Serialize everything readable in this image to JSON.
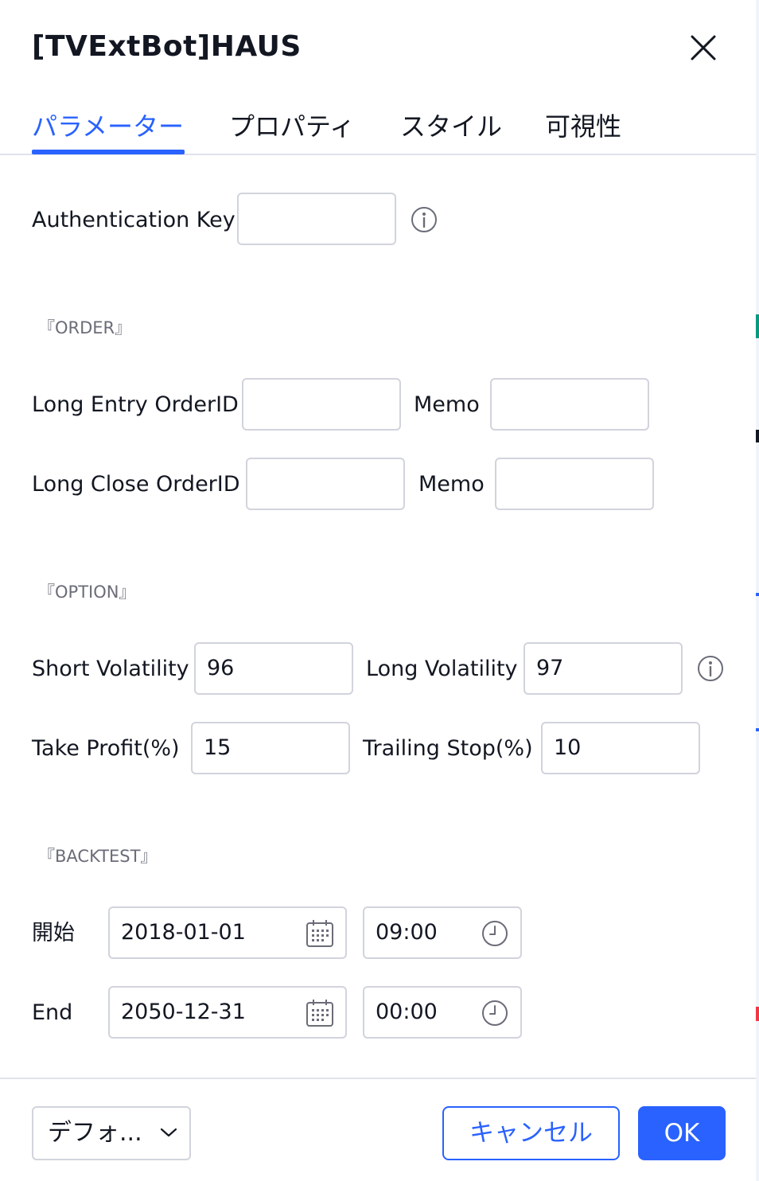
{
  "dialog": {
    "title": "[TVExtBot]HAUS"
  },
  "tabs": [
    {
      "label": "パラメーター",
      "active": true
    },
    {
      "label": "プロパティ",
      "active": false
    },
    {
      "label": "スタイル",
      "active": false
    },
    {
      "label": "可視性",
      "active": false
    }
  ],
  "auth": {
    "label": "Authentication Key",
    "value": ""
  },
  "order": {
    "section": "『ORDER』",
    "long_entry_label": "Long Entry OrderID",
    "long_entry_value": "",
    "memo1_label": "Memo",
    "memo1_value": "",
    "long_close_label": "Long Close OrderID",
    "long_close_value": "",
    "memo2_label": "Memo",
    "memo2_value": ""
  },
  "option": {
    "section": "『OPTION』",
    "short_vol_label": "Short Volatility",
    "short_vol_value": "96",
    "long_vol_label": "Long Volatility",
    "long_vol_value": "97",
    "take_profit_label": "Take Profit(%)",
    "take_profit_value": "15",
    "trailing_stop_label": "Trailing Stop(%)",
    "trailing_stop_value": "10"
  },
  "backtest": {
    "section": "『BACKTEST』",
    "start_label": "開始",
    "start_date": "2018-01-01",
    "start_time": "09:00",
    "end_label": "End",
    "end_date": "2050-12-31",
    "end_time": "00:00"
  },
  "footer": {
    "defaults_label": "デフォ...",
    "cancel_label": "キャンセル",
    "ok_label": "OK"
  },
  "colors": {
    "accent": "#2962ff",
    "border": "#d1d4dc",
    "text": "#131722",
    "muted": "#6a6d78"
  },
  "icons": [
    "close-icon",
    "info-icon",
    "calendar-icon",
    "clock-icon",
    "chevron-down-icon"
  ]
}
